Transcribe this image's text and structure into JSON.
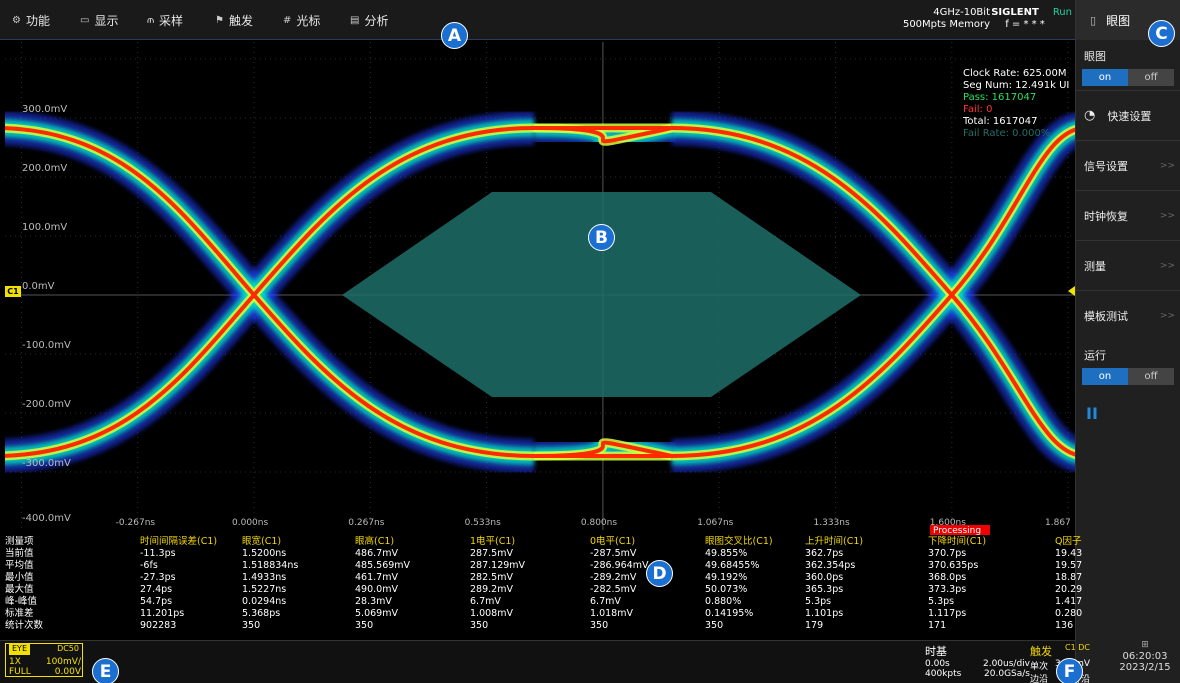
{
  "menu": [
    {
      "icon": "gear-icon",
      "glyph": "⚙",
      "label": "功能"
    },
    {
      "icon": "display-icon",
      "glyph": "▭",
      "label": "显示"
    },
    {
      "icon": "sample-icon",
      "glyph": "⫙",
      "label": "采样"
    },
    {
      "icon": "trigger-flag-icon",
      "glyph": "⚑",
      "label": "触发"
    },
    {
      "icon": "cursor-icon",
      "glyph": "#",
      "label": "光标"
    },
    {
      "icon": "analyze-icon",
      "glyph": "▤",
      "label": "分析"
    }
  ],
  "status": {
    "bandwidth": "4GHz-10Bit",
    "memory": "500Mpts Memory",
    "brand": "SIGLENT",
    "run": "Run",
    "freq": "f = * * *"
  },
  "right_panel": {
    "title": "眼图",
    "eye_label": "眼图",
    "eye_toggle": {
      "on": "on",
      "off": "off"
    },
    "items": [
      "快速设置",
      "信号设置",
      "时钟恢复",
      "测量",
      "模板测试"
    ],
    "run_label": "运行",
    "run_toggle": {
      "on": "on",
      "off": "off"
    },
    "pause": "II"
  },
  "plot": {
    "y_labels": [
      "300.0mV",
      "200.0mV",
      "100.0mV",
      "0.0mV",
      "-100.0mV",
      "-200.0mV",
      "-300.0mV",
      "-400.0mV"
    ],
    "x_labels": [
      "-0.267ns",
      "0.000ns",
      "0.267ns",
      "0.533ns",
      "0.800ns",
      "1.067ns",
      "1.333ns",
      "1.600ns",
      "1.867"
    ],
    "channel": "C1",
    "stats": {
      "clock_rate": "Clock Rate: 625.00M",
      "seg_num": "Seg Num: 12.491k UI",
      "pass": "Pass: 1617047",
      "fail": "Fail: 0",
      "total": "Total: 1617047",
      "fail_rate": "Fail Rate: 0.000%"
    },
    "processing": "Processing",
    "colors": {
      "pass": "#2ee05a",
      "fail": "#ff3030",
      "mask": "#1f6f6a",
      "trace_outer": "#1b3bff",
      "trace_mid": "#00e5c0",
      "trace_core": "#ff2a00"
    }
  },
  "measurements": {
    "headers": [
      "测量项",
      "时间间隔误差(C1)",
      "眼宽(C1)",
      "眼高(C1)",
      "1电平(C1)",
      "0电平(C1)",
      "眼图交叉比(C1)",
      "上升时间(C1)",
      "下降时间(C1)",
      "Q因子"
    ],
    "rows": [
      [
        "当前值",
        "-11.3ps",
        "1.5200ns",
        "486.7mV",
        "287.5mV",
        "-287.5mV",
        "49.855%",
        "362.7ps",
        "370.7ps",
        "19.43"
      ],
      [
        "平均值",
        "-6fs",
        "1.518834ns",
        "485.569mV",
        "287.129mV",
        "-286.964mV",
        "49.68455%",
        "362.354ps",
        "370.635ps",
        "19.57"
      ],
      [
        "最小值",
        "-27.3ps",
        "1.4933ns",
        "461.7mV",
        "282.5mV",
        "-289.2mV",
        "49.192%",
        "360.0ps",
        "368.0ps",
        "18.87"
      ],
      [
        "最大值",
        "27.4ps",
        "1.5227ns",
        "490.0mV",
        "289.2mV",
        "-282.5mV",
        "50.073%",
        "365.3ps",
        "373.3ps",
        "20.29"
      ],
      [
        "峰-峰值",
        "54.7ps",
        "0.0294ns",
        "28.3mV",
        "6.7mV",
        "6.7mV",
        "0.880%",
        "5.3ps",
        "5.3ps",
        "1.417"
      ],
      [
        "标准差",
        "11.201ps",
        "5.368ps",
        "5.069mV",
        "1.008mV",
        "1.018mV",
        "0.14195%",
        "1.101ps",
        "1.117ps",
        "0.280"
      ],
      [
        "统计次数",
        "902283",
        "350",
        "350",
        "350",
        "350",
        "350",
        "179",
        "171",
        "136"
      ]
    ]
  },
  "bottom": {
    "channel_box": {
      "mode": "EYE",
      "coupling": "DC50",
      "probe": "1X",
      "scale": "100mV/",
      "bw": "FULL",
      "offset": "0.00V"
    },
    "timebase": {
      "title": "时基",
      "delay": "0.00s",
      "scale": "2.00us/div",
      "memory": "400kpts",
      "rate": "20.0GSa/s"
    },
    "trigger": {
      "title": "触发",
      "source": "C1 DC",
      "mode": "单次",
      "level": "3.00mV",
      "type": "边沿",
      "slope": "上升沿"
    },
    "clock": {
      "time": "06:20:03",
      "date": "2023/2/15"
    }
  },
  "callouts": [
    "A",
    "B",
    "C",
    "D",
    "E",
    "F"
  ]
}
